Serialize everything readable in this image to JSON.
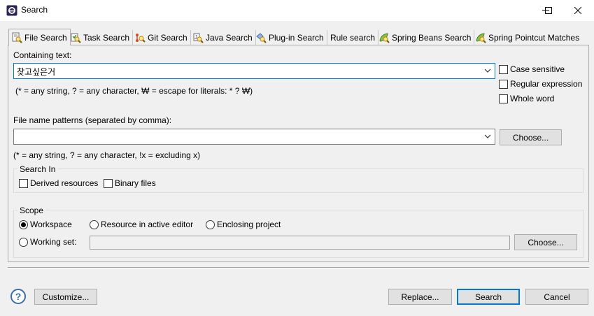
{
  "window": {
    "title": "Search",
    "minimize_glyph": "—",
    "maximize_glyph": "☐",
    "close_glyph": "✕"
  },
  "tabs": [
    {
      "label": "File Search",
      "icon": "file-search-icon",
      "active": true
    },
    {
      "label": "Task Search",
      "icon": "task-search-icon"
    },
    {
      "label": "Git Search",
      "icon": "git-search-icon"
    },
    {
      "label": "Java Search",
      "icon": "java-search-icon"
    },
    {
      "label": "Plug-in Search",
      "icon": "plugin-search-icon"
    },
    {
      "label": "Rule search",
      "icon": ""
    },
    {
      "label": "Spring Beans Search",
      "icon": "spring-beans-search-icon"
    },
    {
      "label": "Spring Pointcut Matches",
      "icon": "spring-pointcut-icon"
    }
  ],
  "containing_text": {
    "label": "Containing text:",
    "value": "찾고싶은거",
    "hint": "(* = any string, ? = any character, ₩ = escape for literals: * ? ₩)"
  },
  "options": {
    "case_sensitive": {
      "label": "Case sensitive",
      "checked": false
    },
    "regular_expression": {
      "label": "Regular expression",
      "checked": false
    },
    "whole_word": {
      "label": "Whole word",
      "checked": false
    }
  },
  "file_patterns": {
    "label": "File name patterns (separated by comma):",
    "value": "",
    "hint": "(* = any string, ? = any character, !x = excluding x)",
    "choose_label": "Choose..."
  },
  "search_in": {
    "title": "Search In",
    "derived_resources": {
      "label": "Derived resources",
      "checked": false
    },
    "binary_files": {
      "label": "Binary files",
      "checked": false
    }
  },
  "scope": {
    "title": "Scope",
    "workspace": {
      "label": "Workspace",
      "selected": true
    },
    "resource_in_active_editor": {
      "label": "Resource in active editor",
      "selected": false
    },
    "enclosing_project": {
      "label": "Enclosing project",
      "selected": false
    },
    "working_set": {
      "label": "Working set:",
      "selected": false,
      "value": ""
    },
    "choose_label": "Choose..."
  },
  "footer": {
    "help_glyph": "?",
    "customize_label": "Customize...",
    "replace_label": "Replace...",
    "search_label": "Search",
    "cancel_label": "Cancel"
  },
  "colors": {
    "focus_border": "#0078d7",
    "dialog_bg": "#f0f0f0"
  }
}
